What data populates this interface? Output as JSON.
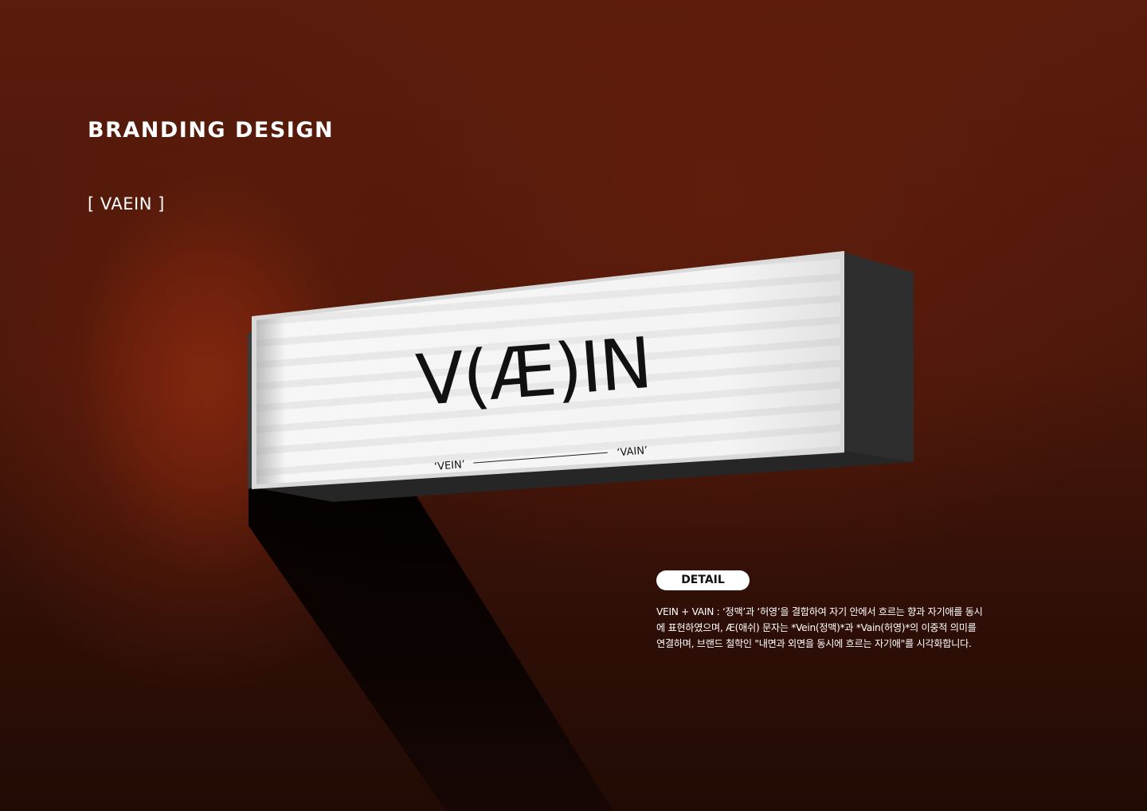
{
  "header": {
    "title": "BRANDING DESIGN",
    "subtitle": "[ VAEIN ]"
  },
  "sign": {
    "logo": "V(Æ)IN",
    "left_label": "‘VEIN’",
    "right_label": "‘VAIN’"
  },
  "detail": {
    "badge": "DETAIL",
    "description": "VEIN + VAIN : ‘정맥’과 ‘허영’을 결합하여 자기 안에서 흐르는 향과 자기애를 동시에 표현하였으며, Æ(애쉬) 문자는 *Vein(정맥)*과 *Vain(허영)*의 이중적 의미를 연결하며, 브랜드 철학인 \"내면과 외면을 동시에 흐르는 자기애\"를 시각화합니다."
  },
  "colors": {
    "background": "#4a170a",
    "sign_face": "#f2f2f2",
    "sign_body": "#2b2b2b",
    "text": "#ffffff"
  }
}
